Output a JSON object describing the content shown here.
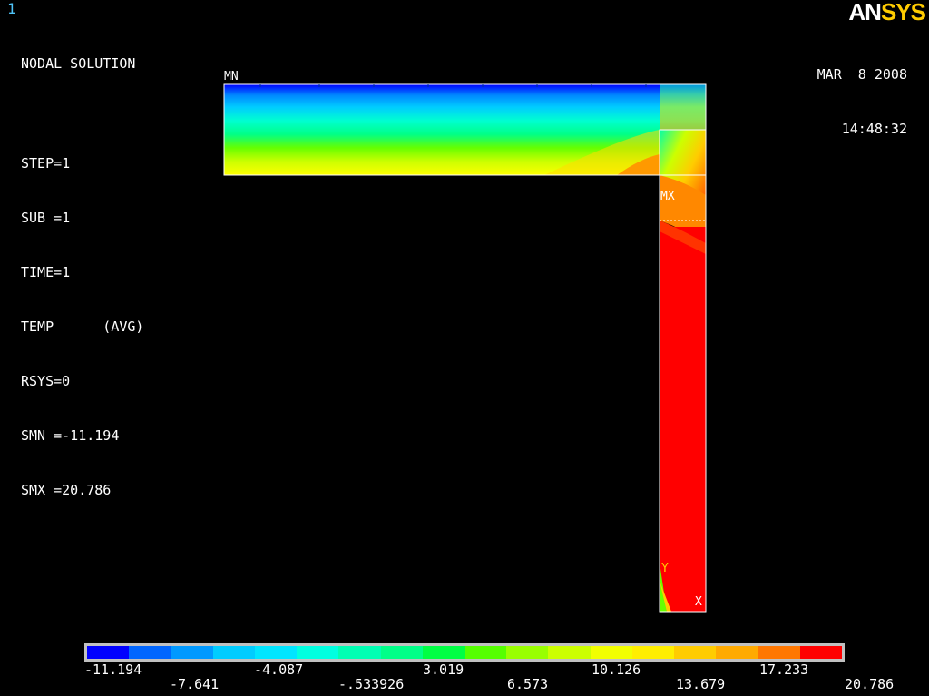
{
  "window_number": "1",
  "info_lines": {
    "title": "NODAL SOLUTION",
    "step": "STEP=1",
    "sub": "SUB =1",
    "time": "TIME=1",
    "temp": "TEMP      (AVG)",
    "rsys": "RSYS=0",
    "smn": "SMN =-11.194",
    "smx": "SMX =20.786"
  },
  "logo": {
    "an": "AN",
    "sys": "SYS"
  },
  "date": "MAR  8 2008",
  "time": "14:48:32",
  "markers": {
    "mn": "MN",
    "mx": "MX",
    "axis_y": "Y",
    "axis_x": "X"
  },
  "legend": {
    "colors": [
      "#0000ff",
      "#0066ff",
      "#0099ff",
      "#00ccff",
      "#00e5ff",
      "#00ffe0",
      "#00ffb3",
      "#00ff88",
      "#00ff44",
      "#55ff00",
      "#99ff00",
      "#ccff00",
      "#f2ff00",
      "#ffee00",
      "#ffcc00",
      "#ffaa00",
      "#ff7700",
      "#ff0000"
    ],
    "labels_top": [
      "-11.194",
      "-4.087",
      "3.019",
      "10.126",
      "17.233"
    ],
    "labels_bottom": [
      "-7.641",
      "-.533926",
      "6.573",
      "13.679",
      "20.786"
    ]
  }
}
